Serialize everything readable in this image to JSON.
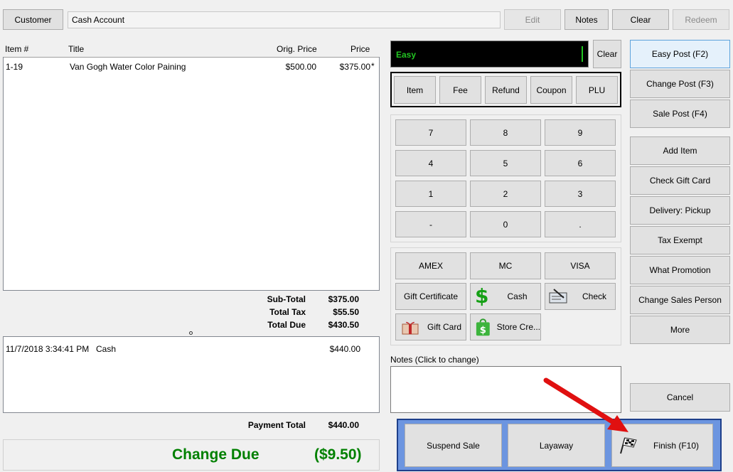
{
  "top": {
    "customer_label": "Customer",
    "customer_value": "Cash Account",
    "edit_label": "Edit",
    "notes_label": "Notes",
    "clear_label": "Clear",
    "redeem_label": "Redeem"
  },
  "items": {
    "headers": {
      "item": "Item #",
      "title": "Title",
      "orig_price": "Orig. Price",
      "price": "Price"
    },
    "rows": [
      {
        "item": "1-19",
        "title": "Van Gogh Water Color Paining",
        "orig_price": "$500.00",
        "price": "$375.00",
        "flag": "*"
      }
    ]
  },
  "totals": {
    "subtotal_label": "Sub-Total",
    "subtotal": "$375.00",
    "tax_label": "Total Tax",
    "tax": "$55.50",
    "due_label": "Total Due",
    "due": "$430.50"
  },
  "payments": {
    "rows": [
      {
        "date": "11/7/2018 3:34:41 PM",
        "method": "Cash",
        "amount": "$440.00"
      }
    ],
    "total_label": "Payment Total",
    "total": "$440.00"
  },
  "change": {
    "label": "Change Due",
    "value": "($9.50)",
    "color": "#008000"
  },
  "entry": {
    "mode_text": "Easy",
    "mode_color": "#22c522",
    "clear_label": "Clear"
  },
  "entry_types": [
    "Item",
    "Fee",
    "Refund",
    "Coupon",
    "PLU"
  ],
  "keypad": [
    "7",
    "8",
    "9",
    "4",
    "5",
    "6",
    "1",
    "2",
    "3",
    "-",
    "0",
    "."
  ],
  "tenders": {
    "amex": "AMEX",
    "mc": "MC",
    "visa": "VISA",
    "gift_certificate": "Gift Certificate",
    "cash": "Cash",
    "check": "Check",
    "gift_card": "Gift Card",
    "store_credit": "Store Cre..."
  },
  "notes": {
    "label": "Notes (Click to change)",
    "value": ""
  },
  "actions": {
    "easy_post": "Easy Post (F2)",
    "change_post": "Change Post (F3)",
    "sale_post": "Sale Post (F4)",
    "add_item": "Add Item",
    "check_gift_card": "Check Gift Card",
    "delivery": "Delivery: Pickup",
    "tax_exempt": "Tax Exempt",
    "what_promotion": "What Promotion",
    "change_sales_person": "Change Sales Person",
    "more": "More",
    "cancel": "Cancel"
  },
  "finish_bar": {
    "suspend": "Suspend Sale",
    "layaway": "Layaway",
    "finish": "Finish (F10)",
    "bar_color": "#6c95e0"
  },
  "colors": {
    "arrow": "#e01010",
    "highlight_border": "#5ea3dc"
  }
}
